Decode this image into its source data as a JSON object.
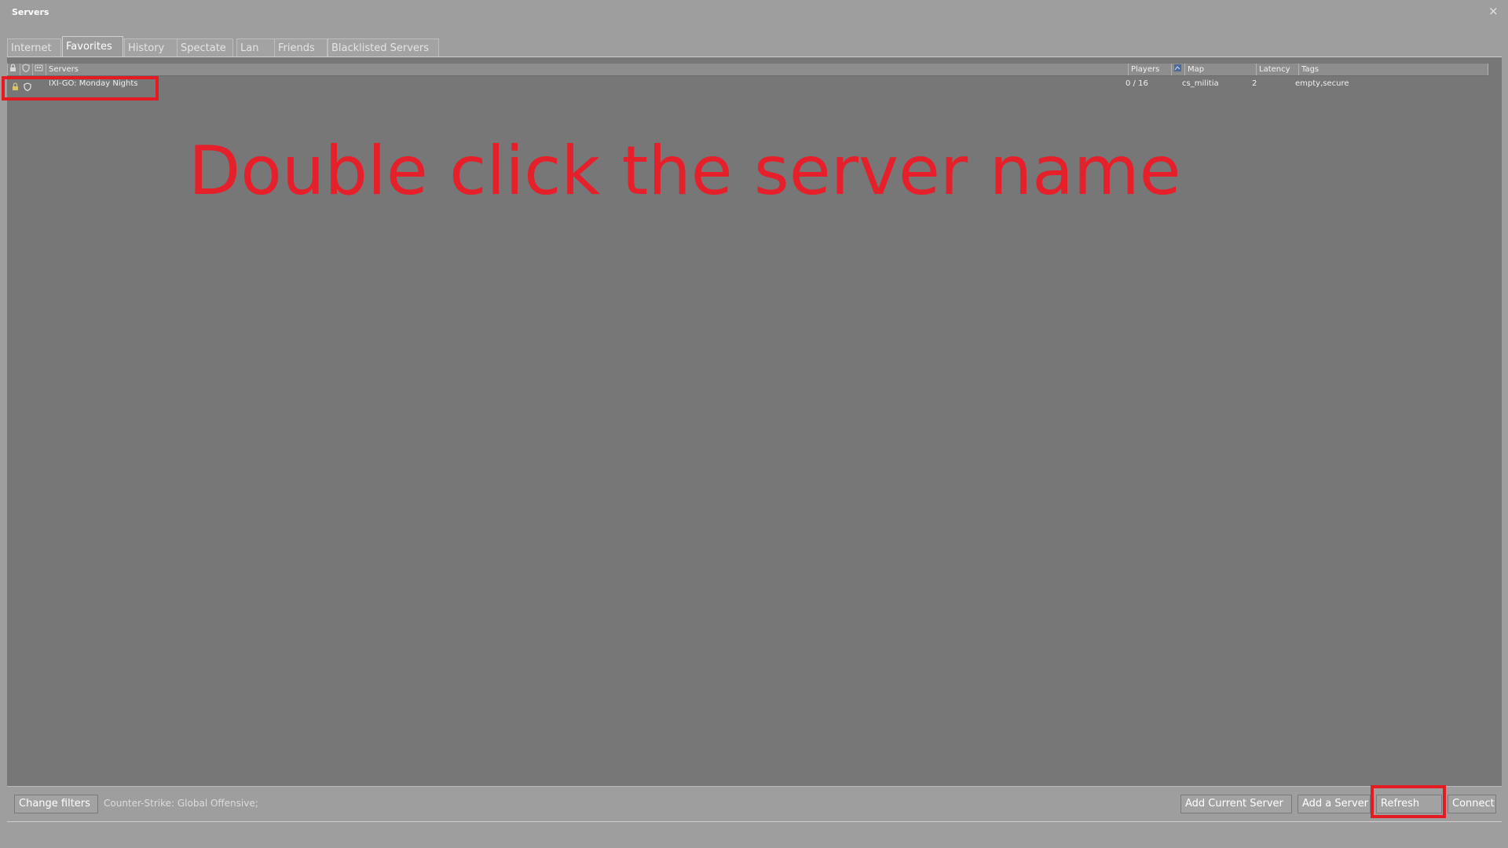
{
  "window": {
    "title": "Servers",
    "close_glyph": "×"
  },
  "tabs": [
    {
      "label": "Internet"
    },
    {
      "label": "Favorites",
      "active": true
    },
    {
      "label": "History"
    },
    {
      "label": "Spectate"
    },
    {
      "label": "Lan"
    },
    {
      "label": "Friends"
    },
    {
      "label": "Blacklisted Servers"
    }
  ],
  "columns": {
    "lock": "lock-icon",
    "secure": "shield-icon",
    "bots": "bots-icon",
    "servers": "Servers",
    "players": "Players",
    "map_icon": "map-icon",
    "map": "Map",
    "latency": "Latency",
    "tags": "Tags"
  },
  "rows": [
    {
      "name": "IXI-GO: Monday Nights",
      "players": "0 / 16",
      "map": "cs_militia",
      "latency": "2",
      "tags": "empty,secure",
      "locked": true,
      "secure": true
    }
  ],
  "annotation": {
    "text": "Double click the server name",
    "color": "#e5202a"
  },
  "footer": {
    "change_filters": "Change filters",
    "filter_text": "Counter-Strike: Global Offensive;",
    "add_current_server": "Add Current Server",
    "add_a_server": "Add a Server",
    "refresh": "Refresh",
    "connect": "Connect"
  },
  "colors": {
    "window_bg": "#9e9e9e",
    "list_bg": "#777777",
    "highlight": "#e51b24"
  }
}
